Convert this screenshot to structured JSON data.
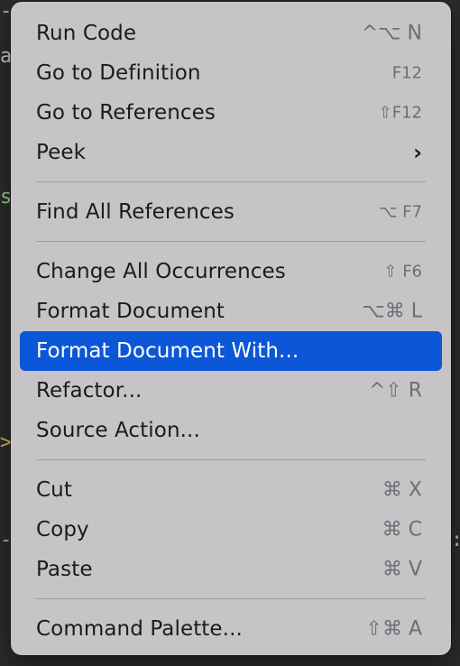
{
  "colors": {
    "menu_bg": "#c7c4c8",
    "selected_bg": "#0b57d8",
    "text": "#1b1b1d",
    "shortcut": "#6f6d72"
  },
  "menu": {
    "groups": [
      [
        {
          "label": "Run Code",
          "shortcut": "^⌥ N"
        },
        {
          "label": "Go to Definition",
          "shortcut": "F12"
        },
        {
          "label": "Go to References",
          "shortcut": "⇧F12"
        },
        {
          "label": "Peek",
          "submenu_icon": "chevron-right-icon"
        }
      ],
      [
        {
          "label": "Find All References",
          "shortcut": "⌥ F7"
        }
      ],
      [
        {
          "label": "Change All Occurrences",
          "shortcut": "⇧ F6"
        },
        {
          "label": "Format Document",
          "shortcut": "⌥⌘ L"
        },
        {
          "label": "Format Document With...",
          "selected": true
        },
        {
          "label": "Refactor...",
          "shortcut": "^⇧ R"
        },
        {
          "label": "Source Action..."
        }
      ],
      [
        {
          "label": "Cut",
          "shortcut": "⌘ X"
        },
        {
          "label": "Copy",
          "shortcut": "⌘ C"
        },
        {
          "label": "Paste",
          "shortcut": "⌘ V"
        }
      ],
      [
        {
          "label": "Command Palette...",
          "shortcut": "⇧⌘ A"
        }
      ]
    ]
  }
}
